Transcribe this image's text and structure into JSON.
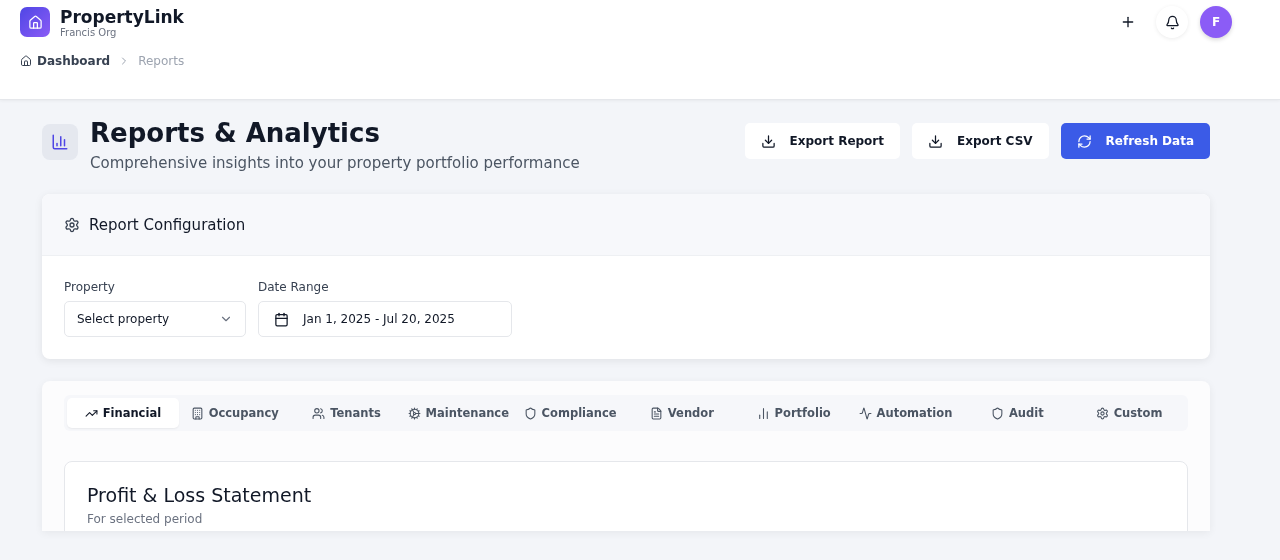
{
  "app": {
    "name": "PropertyLink",
    "org": "Francis Org",
    "avatar": "F"
  },
  "breadcrumb": [
    "Dashboard",
    "Reports"
  ],
  "page": {
    "title": "Reports & Analytics",
    "subtitle": "Comprehensive insights into your property portfolio performance"
  },
  "actions": [
    {
      "label": "Export Report",
      "kind": "export"
    },
    {
      "label": "Export CSV",
      "kind": "export"
    },
    {
      "label": "Refresh Data",
      "kind": "refresh"
    }
  ],
  "config": {
    "title": "Report Configuration",
    "fields": [
      {
        "label": "Property",
        "placeholder": "Select property",
        "kind": "select"
      },
      {
        "label": "Date Range",
        "value": "Jan 1, 2025 - Jul 20, 2025",
        "kind": "date"
      }
    ]
  },
  "tabs": [
    {
      "label": "Financial",
      "selected": true
    },
    {
      "label": "Occupancy",
      "selected": false
    },
    {
      "label": "Tenants",
      "selected": false
    },
    {
      "label": "Maintenance",
      "selected": false
    },
    {
      "label": "Compliance",
      "selected": false
    },
    {
      "label": "Vendor",
      "selected": false
    },
    {
      "label": "Portfolio",
      "selected": false
    },
    {
      "label": "Automation",
      "selected": false
    },
    {
      "label": "Audit",
      "selected": false
    },
    {
      "label": "Custom",
      "selected": false
    }
  ],
  "statement": {
    "title": "Profit & Loss Statement",
    "subtitle": "For selected period"
  }
}
